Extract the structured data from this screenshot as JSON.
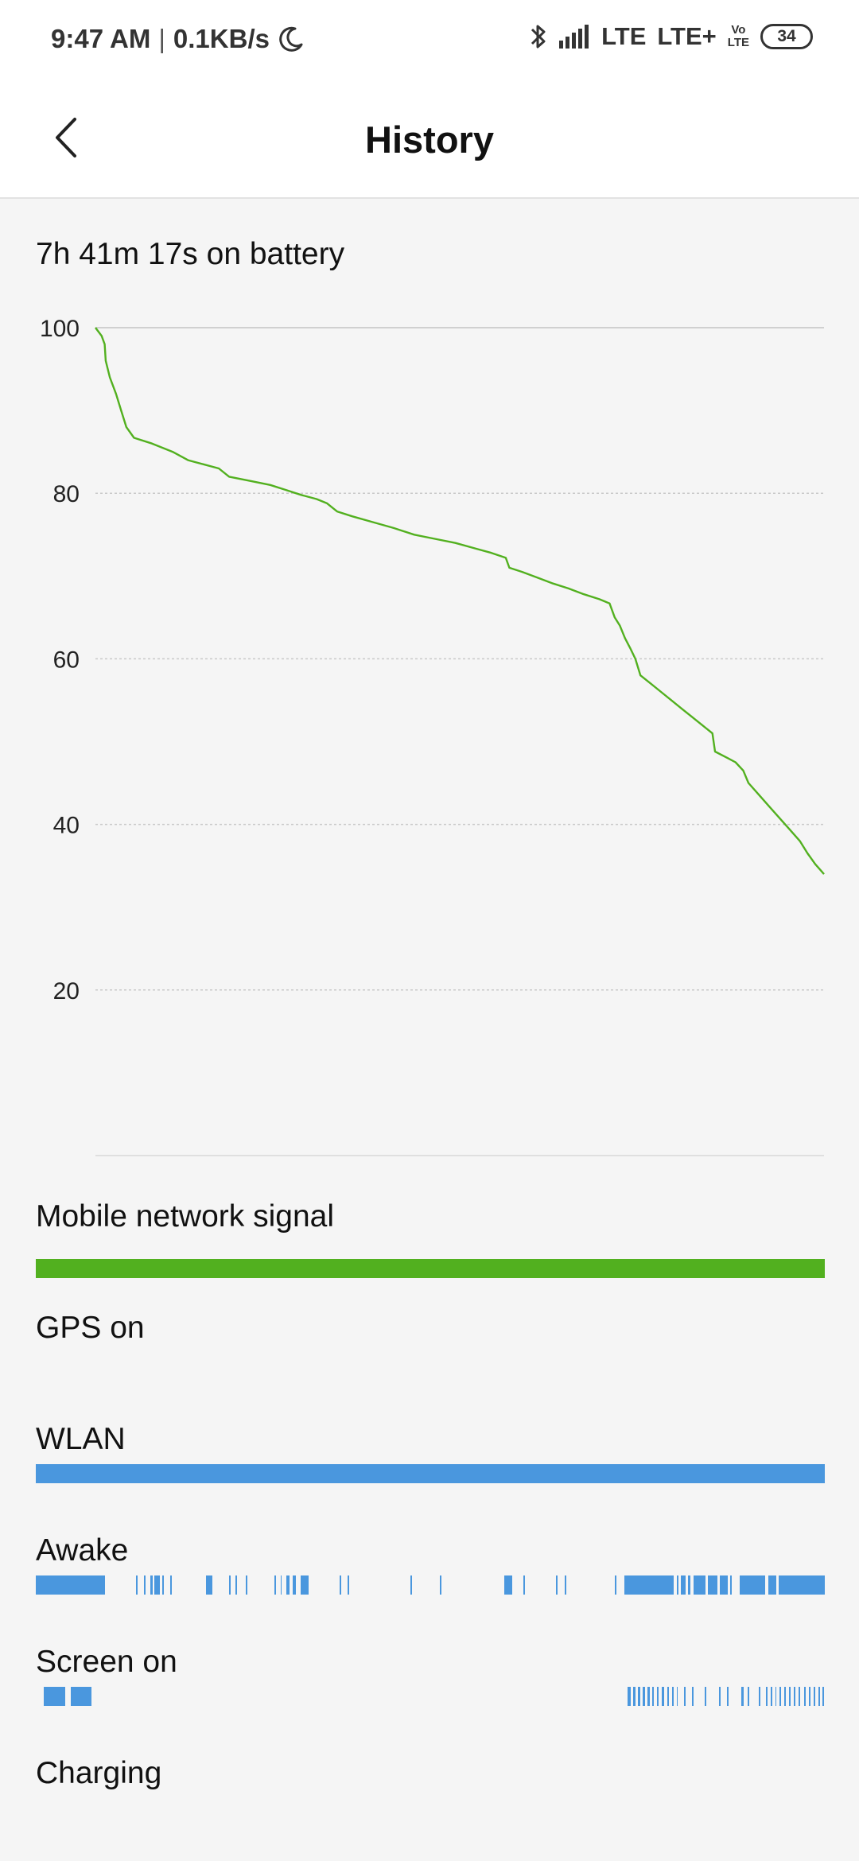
{
  "status_bar": {
    "time": "9:47 AM",
    "separator": "|",
    "net_speed": "0.1KB/s",
    "network_1": "LTE",
    "network_2": "LTE+",
    "volte_top": "Vo",
    "volte_bottom": "LTE",
    "battery_level": "34",
    "icons": [
      "moon-icon",
      "bluetooth-icon",
      "signal-icon",
      "battery-icon"
    ]
  },
  "app_bar": {
    "title": "History",
    "back_icon": "chevron-left-icon"
  },
  "battery": {
    "summary": "7h 41m 17s on battery"
  },
  "chart_data": {
    "type": "line",
    "y_ticks": [
      "100",
      "80",
      "60",
      "40",
      "20"
    ],
    "ylim": [
      0,
      100
    ],
    "series": [
      {
        "values": [
          [
            0.0,
            100.0
          ],
          [
            0.012,
            99.0
          ],
          [
            0.018,
            98.0
          ],
          [
            0.02,
            96.0
          ],
          [
            0.028,
            94.0
          ],
          [
            0.04,
            92.0
          ],
          [
            0.05,
            90.0
          ],
          [
            0.06,
            88.0
          ],
          [
            0.075,
            86.7
          ],
          [
            0.11,
            86.0
          ],
          [
            0.15,
            85.0
          ],
          [
            0.18,
            84.0
          ],
          [
            0.21,
            83.5
          ],
          [
            0.24,
            83.0
          ],
          [
            0.26,
            82.0
          ],
          [
            0.3,
            81.5
          ],
          [
            0.34,
            81.0
          ],
          [
            0.37,
            80.4
          ],
          [
            0.4,
            79.8
          ],
          [
            0.43,
            79.3
          ],
          [
            0.45,
            78.8
          ],
          [
            0.47,
            77.8
          ],
          [
            0.5,
            77.2
          ],
          [
            0.54,
            76.5
          ],
          [
            0.58,
            75.8
          ],
          [
            0.62,
            75.0
          ],
          [
            0.66,
            74.5
          ],
          [
            0.7,
            74.0
          ],
          [
            0.74,
            73.3
          ],
          [
            0.77,
            72.8
          ],
          [
            0.798,
            72.2
          ],
          [
            0.805,
            71.0
          ],
          [
            0.83,
            70.5
          ],
          [
            0.86,
            69.8
          ],
          [
            0.89,
            69.1
          ],
          [
            0.92,
            68.5
          ],
          [
            0.95,
            67.8
          ],
          [
            0.98,
            67.2
          ],
          [
            1.0,
            66.7
          ],
          [
            1.01,
            65.0
          ],
          [
            1.02,
            64.0
          ],
          [
            1.03,
            62.5
          ],
          [
            1.04,
            61.3
          ],
          [
            1.05,
            60.0
          ],
          [
            1.06,
            58.0
          ],
          [
            1.08,
            57.0
          ],
          [
            1.1,
            56.0
          ],
          [
            1.12,
            55.0
          ],
          [
            1.14,
            54.0
          ],
          [
            1.16,
            53.0
          ],
          [
            1.18,
            52.0
          ],
          [
            1.2,
            51.0
          ],
          [
            1.205,
            48.8
          ],
          [
            1.23,
            48.0
          ],
          [
            1.245,
            47.5
          ],
          [
            1.26,
            46.5
          ],
          [
            1.27,
            45.0
          ],
          [
            1.29,
            43.6
          ],
          [
            1.31,
            42.2
          ],
          [
            1.33,
            40.8
          ],
          [
            1.35,
            39.4
          ],
          [
            1.37,
            38.0
          ],
          [
            1.385,
            36.5
          ],
          [
            1.4,
            35.2
          ],
          [
            1.41,
            34.5
          ],
          [
            1.417,
            34.0
          ]
        ]
      }
    ]
  },
  "tracks": {
    "mobile_signal": {
      "label": "Mobile network signal",
      "color": "#52b01f",
      "segments": [
        [
          0.0,
          1.0
        ]
      ]
    },
    "gps": {
      "label": "GPS on",
      "color": "#4a97de",
      "segments": []
    },
    "wlan": {
      "label": "WLAN",
      "color": "#4a97de",
      "segments": [
        [
          0.0,
          1.0
        ]
      ]
    },
    "awake": {
      "label": "Awake",
      "color": "#4a97de",
      "segments": [
        [
          0.0,
          0.088
        ],
        [
          0.127,
          0.129
        ],
        [
          0.137,
          0.139
        ],
        [
          0.145,
          0.148
        ],
        [
          0.15,
          0.157
        ],
        [
          0.16,
          0.162
        ],
        [
          0.17,
          0.172
        ],
        [
          0.216,
          0.224
        ],
        [
          0.245,
          0.247
        ],
        [
          0.253,
          0.255
        ],
        [
          0.266,
          0.268
        ],
        [
          0.302,
          0.304
        ],
        [
          0.31,
          0.312
        ],
        [
          0.318,
          0.322
        ],
        [
          0.326,
          0.33
        ],
        [
          0.336,
          0.346
        ],
        [
          0.385,
          0.387
        ],
        [
          0.395,
          0.397
        ],
        [
          0.475,
          0.477
        ],
        [
          0.512,
          0.514
        ],
        [
          0.594,
          0.604
        ],
        [
          0.618,
          0.62
        ],
        [
          0.659,
          0.661
        ],
        [
          0.67,
          0.672
        ],
        [
          0.734,
          0.736
        ],
        [
          0.746,
          0.808
        ],
        [
          0.812,
          0.815
        ],
        [
          0.818,
          0.824
        ],
        [
          0.827,
          0.83
        ],
        [
          0.834,
          0.849
        ],
        [
          0.852,
          0.864
        ],
        [
          0.867,
          0.877
        ],
        [
          0.88,
          0.882
        ],
        [
          0.892,
          0.924
        ],
        [
          0.928,
          0.939
        ],
        [
          0.942,
          1.0
        ]
      ]
    },
    "screen_on": {
      "label": "Screen on",
      "color": "#4a97de",
      "segments": [
        [
          0.01,
          0.037
        ],
        [
          0.044,
          0.071
        ],
        [
          0.75,
          0.754
        ],
        [
          0.757,
          0.76
        ],
        [
          0.763,
          0.766
        ],
        [
          0.769,
          0.772
        ],
        [
          0.775,
          0.778
        ],
        [
          0.781,
          0.783
        ],
        [
          0.787,
          0.789
        ],
        [
          0.793,
          0.796
        ],
        [
          0.8,
          0.802
        ],
        [
          0.806,
          0.808
        ],
        [
          0.812,
          0.814
        ],
        [
          0.822,
          0.824
        ],
        [
          0.832,
          0.834
        ],
        [
          0.848,
          0.85
        ],
        [
          0.866,
          0.868
        ],
        [
          0.876,
          0.878
        ],
        [
          0.894,
          0.897
        ],
        [
          0.902,
          0.904
        ],
        [
          0.916,
          0.918
        ],
        [
          0.925,
          0.927
        ],
        [
          0.931,
          0.933
        ],
        [
          0.937,
          0.939
        ],
        [
          0.943,
          0.945
        ],
        [
          0.949,
          0.951
        ],
        [
          0.955,
          0.957
        ],
        [
          0.961,
          0.963
        ],
        [
          0.967,
          0.969
        ],
        [
          0.974,
          0.976
        ],
        [
          0.98,
          0.982
        ],
        [
          0.986,
          0.988
        ],
        [
          0.992,
          0.994
        ],
        [
          0.997,
          0.999
        ]
      ]
    },
    "charging": {
      "label": "Charging",
      "color": "#4a97de",
      "segments": []
    }
  }
}
